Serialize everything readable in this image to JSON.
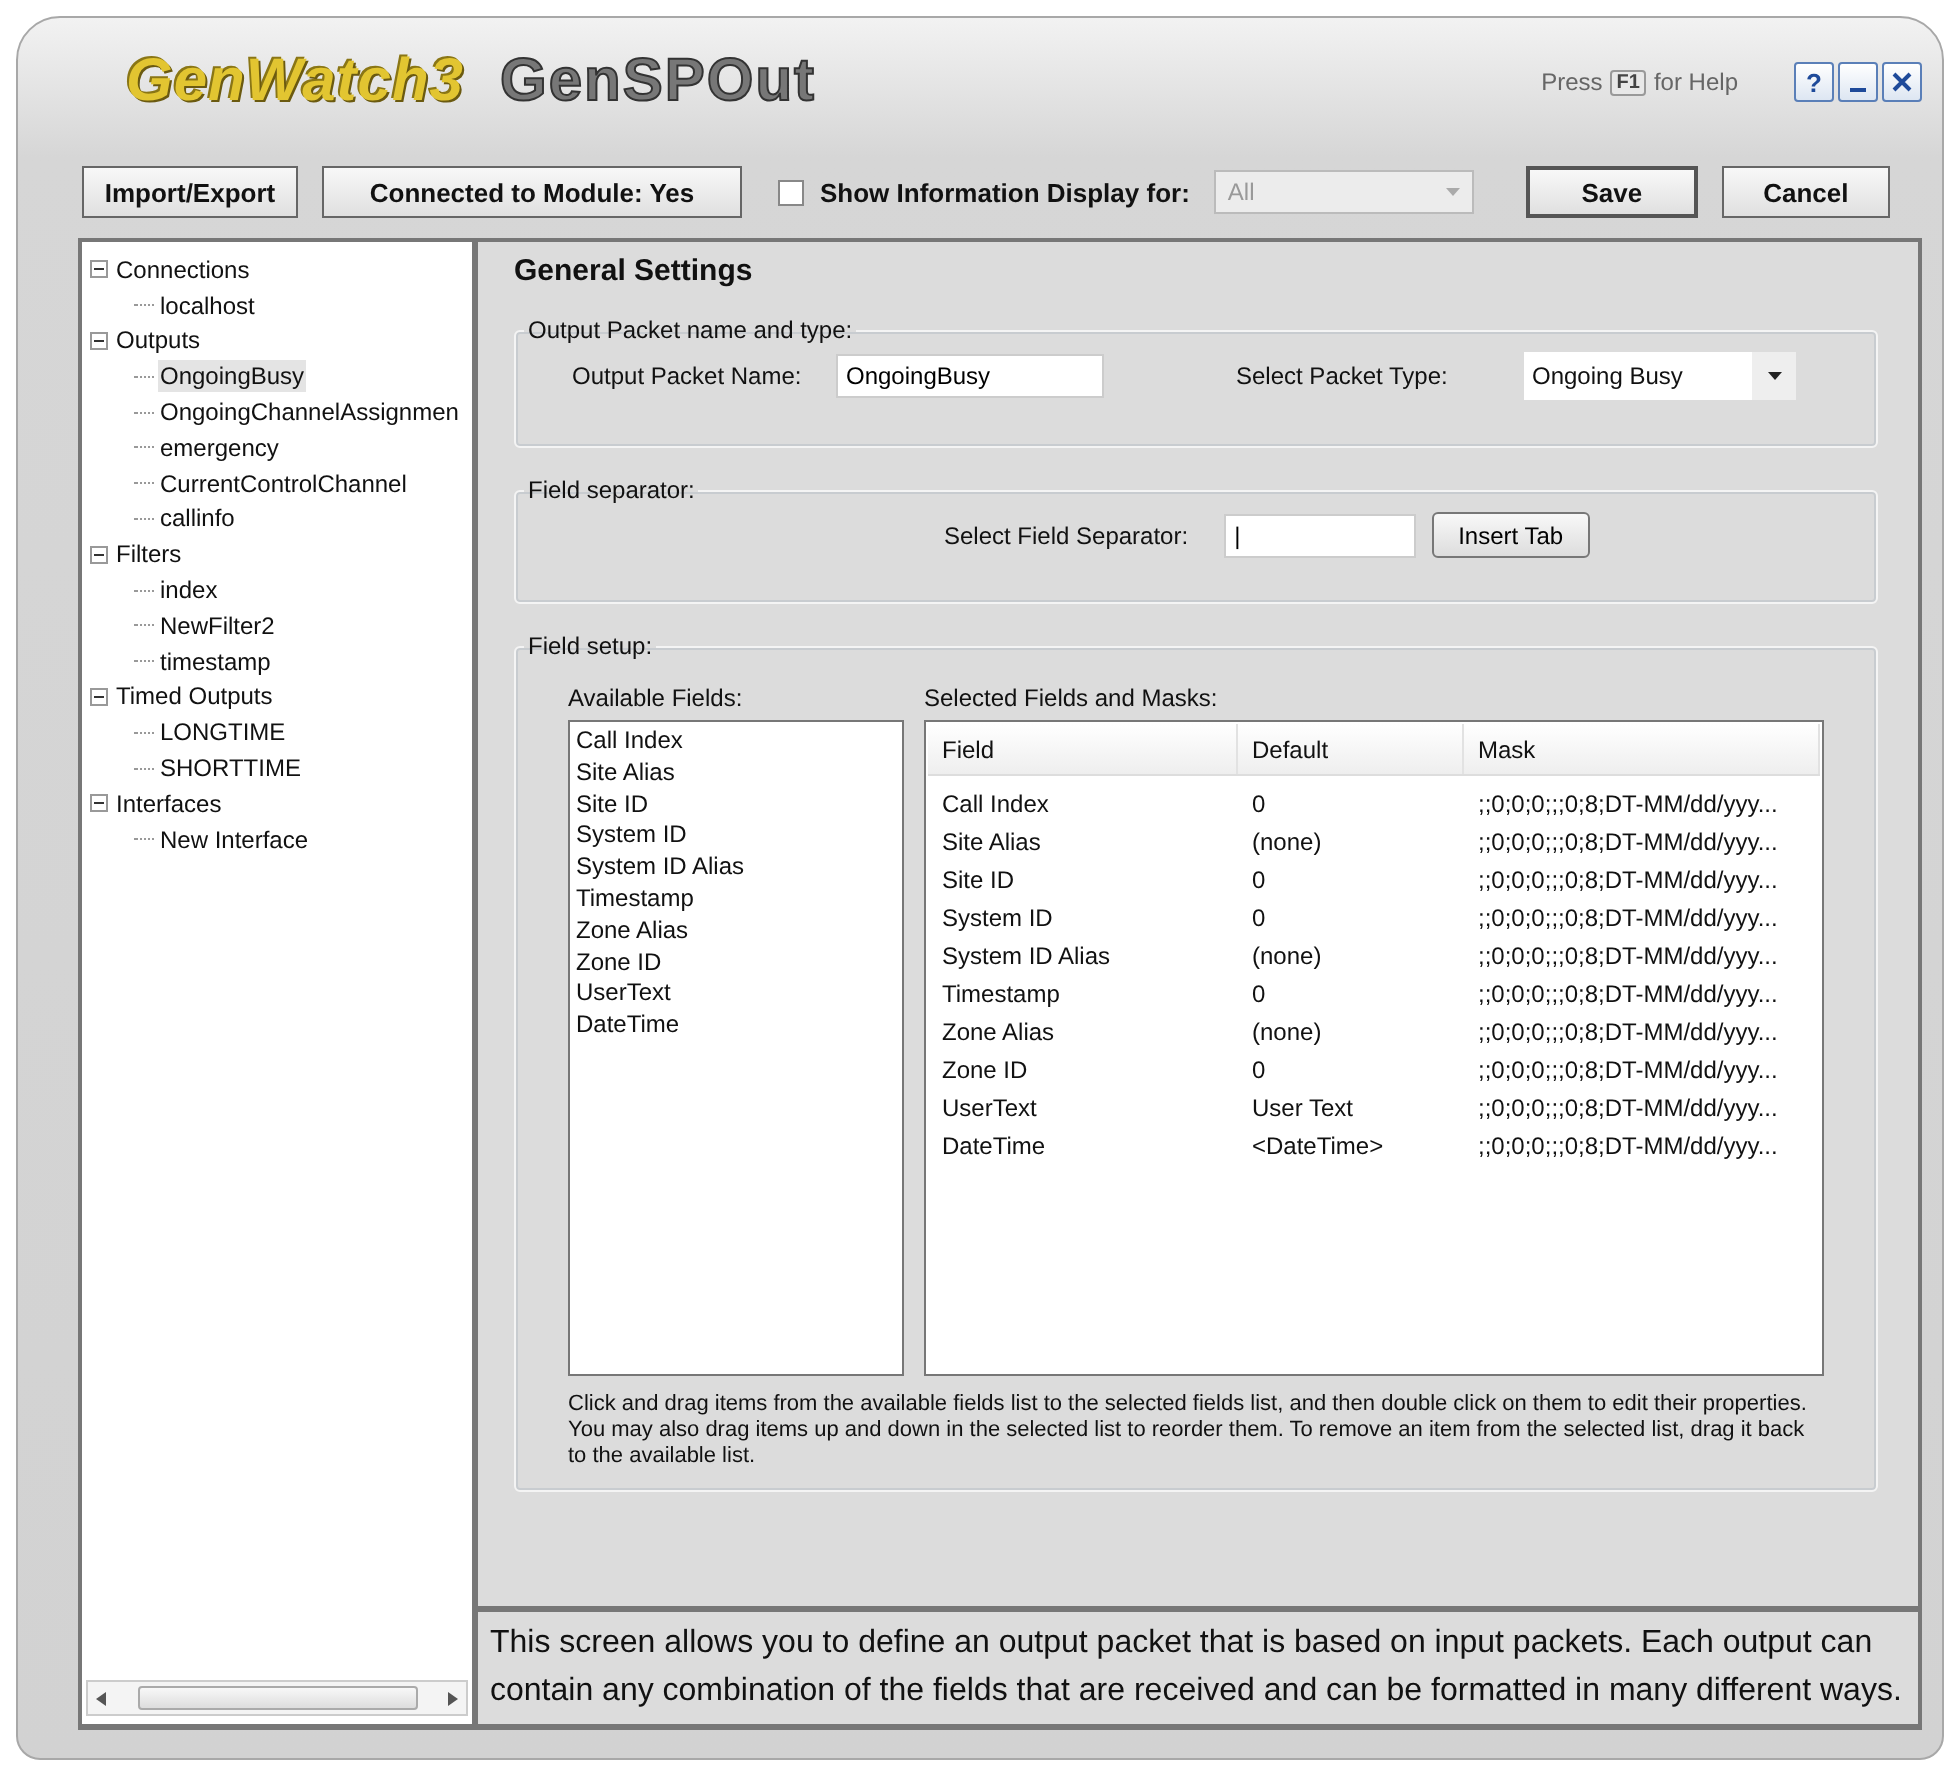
{
  "title_bar": {
    "logo": "GenWatch3",
    "app_title": "GenSPOut",
    "help_prefix": "Press",
    "help_key": "F1",
    "help_suffix": "for Help",
    "help_button": "?"
  },
  "toolbar": {
    "import_export": "Import/Export",
    "connected": "Connected to Module: Yes",
    "show_info": {
      "label": "Show Information Display for:",
      "checked": false
    },
    "display_select": {
      "value": "All",
      "disabled": true
    },
    "save": "Save",
    "cancel": "Cancel"
  },
  "tree": [
    {
      "label": "Connections",
      "expanded": true,
      "selected": false,
      "children": [
        {
          "label": "localhost",
          "selected": false
        }
      ]
    },
    {
      "label": "Outputs",
      "expanded": true,
      "selected": false,
      "children": [
        {
          "label": "OngoingBusy",
          "selected": true
        },
        {
          "label": "OngoingChannelAssignmen",
          "selected": false
        },
        {
          "label": "emergency",
          "selected": false
        },
        {
          "label": "CurrentControlChannel",
          "selected": false
        },
        {
          "label": "callinfo",
          "selected": false
        }
      ]
    },
    {
      "label": "Filters",
      "expanded": true,
      "selected": false,
      "children": [
        {
          "label": "index",
          "selected": false
        },
        {
          "label": "NewFilter2",
          "selected": false
        },
        {
          "label": "timestamp",
          "selected": false
        }
      ]
    },
    {
      "label": "Timed Outputs",
      "expanded": true,
      "selected": false,
      "children": [
        {
          "label": "LONGTIME",
          "selected": false
        },
        {
          "label": "SHORTTIME",
          "selected": false
        }
      ]
    },
    {
      "label": "Interfaces",
      "expanded": true,
      "selected": false,
      "children": [
        {
          "label": "New Interface",
          "selected": false
        }
      ]
    }
  ],
  "settings": {
    "heading": "General Settings",
    "packet_group": {
      "legend": "Output Packet name and type:",
      "name_label": "Output Packet Name:",
      "name_value": "OngoingBusy",
      "type_label": "Select Packet Type:",
      "type_value": "Ongoing Busy"
    },
    "separator_group": {
      "legend": "Field separator:",
      "label": "Select Field Separator:",
      "value": "|",
      "insert_tab": "Insert Tab"
    },
    "field_group": {
      "legend": "Field setup:",
      "available_label": "Available Fields:",
      "available": [
        "Call Index",
        "Site Alias",
        "Site ID",
        "System ID",
        "System ID Alias",
        "Timestamp",
        "Zone Alias",
        "Zone ID",
        "UserText",
        "DateTime"
      ],
      "selected_label": "Selected Fields and Masks:",
      "columns": [
        "Field",
        "Default",
        "Mask"
      ],
      "rows": [
        [
          "Call Index",
          "0",
          ";;0;0;0;;;0;8;DT-MM/dd/yyy..."
        ],
        [
          "Site Alias",
          "(none)",
          ";;0;0;0;;;0;8;DT-MM/dd/yyy..."
        ],
        [
          "Site ID",
          "0",
          ";;0;0;0;;;0;8;DT-MM/dd/yyy..."
        ],
        [
          "System ID",
          "0",
          ";;0;0;0;;;0;8;DT-MM/dd/yyy..."
        ],
        [
          "System ID Alias",
          "(none)",
          ";;0;0;0;;;0;8;DT-MM/dd/yyy..."
        ],
        [
          "Timestamp",
          "0",
          ";;0;0;0;;;0;8;DT-MM/dd/yyy..."
        ],
        [
          "Zone Alias",
          "(none)",
          ";;0;0;0;;;0;8;DT-MM/dd/yyy..."
        ],
        [
          "Zone ID",
          "0",
          ";;0;0;0;;;0;8;DT-MM/dd/yyy..."
        ],
        [
          "UserText",
          "User Text",
          ";;0;0;0;;;0;8;DT-MM/dd/yyy..."
        ],
        [
          "DateTime",
          "<DateTime>",
          ";;0;0;0;;;0;8;DT-MM/dd/yyy..."
        ]
      ],
      "help": "Click and drag items from the available fields list to the selected fields list, and then double click on them to edit their properties.  You may also drag items up and down in the selected list to reorder them.  To remove an item from the selected list, drag it back to the available list."
    }
  },
  "description": "This screen allows you to define an output packet that is based on input packets.  Each output can contain any combination of the fields that are received and can be formatted in many different ways."
}
